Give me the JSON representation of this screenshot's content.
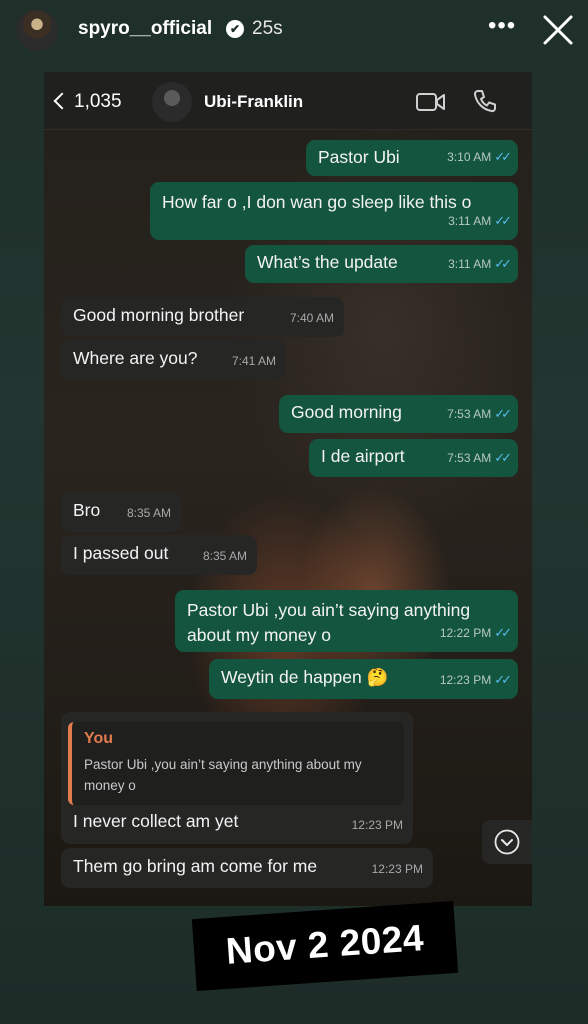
{
  "story": {
    "username": "spyro__official",
    "verified_mark": "✔",
    "time_ago": "25s",
    "more_glyph": "•••"
  },
  "chat": {
    "back_count": "1,035",
    "contact_name": "Ubi-Franklin",
    "messages": [
      {
        "dir": "out",
        "text": "Pastor Ubi",
        "time": "3:10 AM"
      },
      {
        "dir": "out",
        "text": "How far o ,I don wan go sleep like this o",
        "time": "3:11 AM"
      },
      {
        "dir": "out",
        "text": "What’s the update",
        "time": "3:11 AM"
      },
      {
        "dir": "in",
        "text": "Good morning brother",
        "time": "7:40 AM"
      },
      {
        "dir": "in",
        "text": "Where are you?",
        "time": "7:41 AM"
      },
      {
        "dir": "out",
        "text": "Good morning",
        "time": "7:53 AM"
      },
      {
        "dir": "out",
        "text": "I de airport",
        "time": "7:53 AM"
      },
      {
        "dir": "in",
        "text": "Bro",
        "time": "8:35 AM"
      },
      {
        "dir": "in",
        "text": "I passed out",
        "time": "8:35 AM"
      },
      {
        "dir": "out",
        "text": "Pastor Ubi ,you ain’t saying anything about my money o",
        "time": "12:22 PM"
      },
      {
        "dir": "out",
        "text": "Weytin de happen 🤔",
        "time": "12:23 PM"
      },
      {
        "dir": "in",
        "text": "I never collect am yet",
        "time": "12:23 PM"
      },
      {
        "dir": "in",
        "text": "Them go bring am come for me",
        "time": "12:23 PM"
      }
    ],
    "quote": {
      "author": "You",
      "text": "Pastor Ubi ,you ain’t saying anything about my money o"
    },
    "read_ticks": "✓✓"
  },
  "date_sticker": "Nov 2 2024",
  "colors": {
    "outgoing_bubble": "#14553f",
    "incoming_bubble": "#262625",
    "quote_accent": "#e07c4d",
    "read_tick": "#53bdeb"
  },
  "icons": [
    "verified-icon",
    "more-icon",
    "close-icon",
    "back-chevron-icon",
    "video-call-icon",
    "phone-icon",
    "chevron-down-icon"
  ]
}
